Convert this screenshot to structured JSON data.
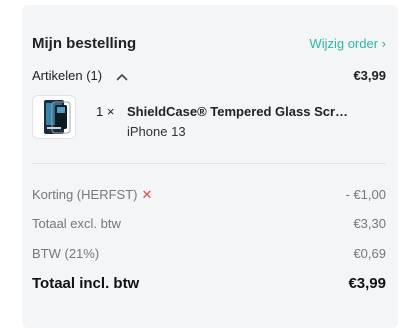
{
  "summary": {
    "title": "Mijn bestelling",
    "edit_link": "Wijzig order ›",
    "items_label": "Artikelen (1)",
    "items_total": "€3,99"
  },
  "product": {
    "quantity": "1 ×",
    "name": "ShieldCase® Tempered Glass Screen Protector",
    "variant": "iPhone 13"
  },
  "lines": [
    {
      "label": "Korting (HERFST)",
      "remove_icon": "✕",
      "value": "- €1,00"
    },
    {
      "label": "Totaal excl. btw",
      "value": "€3,30"
    },
    {
      "label": "BTW (21%)",
      "value": "€0,69"
    }
  ],
  "total": {
    "label": "Totaal incl. btw",
    "value": "€3,99"
  },
  "colors": {
    "accent": "#2fb5a8",
    "remove": "#e0484b",
    "card_background": "#f4f5f7"
  }
}
